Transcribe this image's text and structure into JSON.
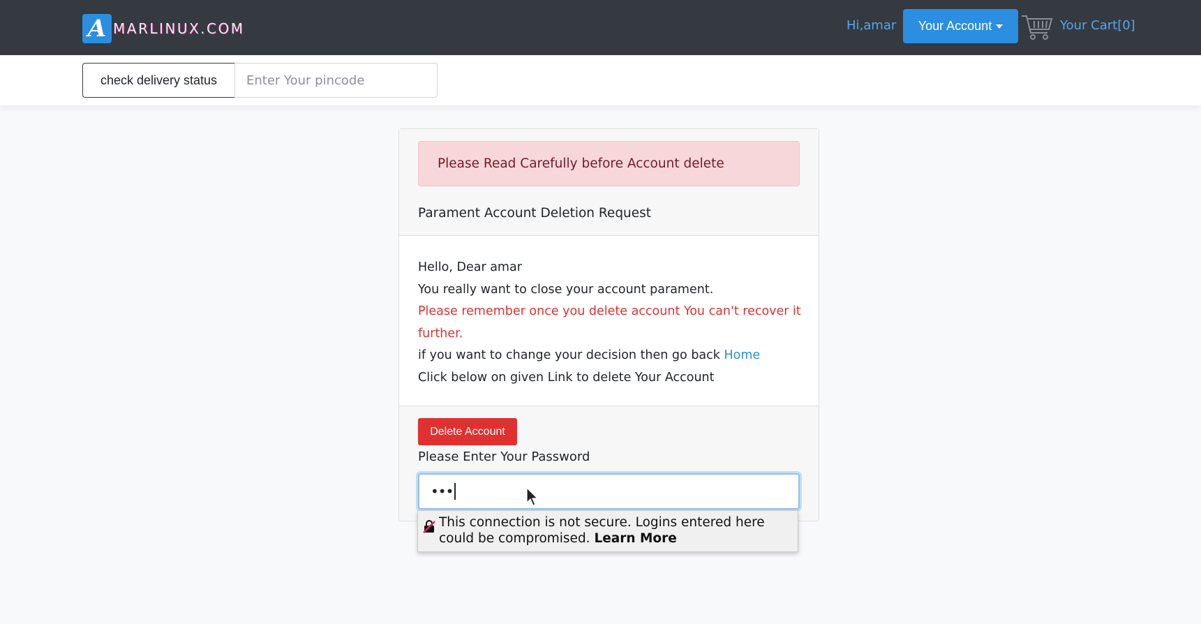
{
  "navbar": {
    "brand_letter": "A",
    "brand_name": "MARLINUX.COM",
    "greeting": "Hi,amar",
    "account_button": "Your Account",
    "cart_label": "Your Cart[0]"
  },
  "delivery": {
    "check_button": "check delivery status",
    "pincode_placeholder": "Enter Your pincode",
    "pincode_value": ""
  },
  "card": {
    "alert": "Please Read Carefully before Account delete",
    "title": "Parament Account Deletion Request",
    "greeting": "Hello, Dear amar",
    "line_confirm": "You really want to close your account parament.",
    "line_warning": "Please remember once you delete account You can't recover it further.",
    "line_change_prefix": "if you want to change your decision then go back",
    "home_link": "Home",
    "line_click": "Click below on given Link to delete Your Account",
    "delete_button": "Delete Account",
    "password_label": "Please Enter Your Password",
    "password_mask": "•••"
  },
  "insecure_popup": {
    "message": "This connection is not secure. Logins entered here could be compromised.",
    "learn_more": "Learn More"
  },
  "colors": {
    "navbar_bg": "#343a40",
    "primary": "#2b8ee0",
    "danger": "#e03131",
    "alert_bg": "#f8d7da",
    "page_bg": "#f8f9fa"
  },
  "icons": [
    "brand-logo-icon",
    "cart-icon",
    "insecure-lock-icon",
    "mouse-cursor-icon",
    "caret-down-icon"
  ]
}
